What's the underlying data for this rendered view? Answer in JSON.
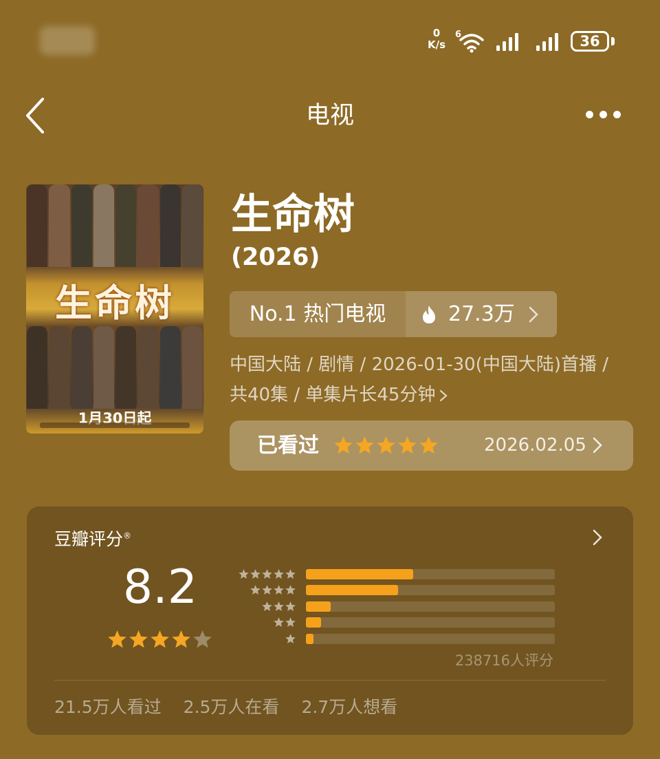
{
  "status_bar": {
    "net_speed_value": "0",
    "net_speed_unit": "K/s",
    "network_type": "6",
    "battery": "36"
  },
  "nav": {
    "title": "电视",
    "back_icon": "chevron-left-icon",
    "more_icon": "more-dots-icon"
  },
  "item": {
    "poster": {
      "logo": "生命树",
      "date": "1月30日起"
    },
    "title": "生命树",
    "year": "(2026)",
    "rank": {
      "label": "No.1 热门电视",
      "heat": "27.3万"
    },
    "meta_line1": "中国大陆 / 剧情 / 2026-01-30(中国大陆)首播 /",
    "meta_line2": "共40集 / 单集片长45分钟",
    "watched": {
      "label": "已看过",
      "my_stars": 5,
      "date": "2026.02.05"
    }
  },
  "rating": {
    "title": "豆瓣评分",
    "reg_mark": "®",
    "score": "8.2",
    "stars": 4,
    "distribution": [
      {
        "stars": 5,
        "fraction": 0.43
      },
      {
        "stars": 4,
        "fraction": 0.37
      },
      {
        "stars": 3,
        "fraction": 0.1
      },
      {
        "stars": 2,
        "fraction": 0.06
      },
      {
        "stars": 1,
        "fraction": 0.03
      }
    ],
    "count": "238716人评分",
    "watched_count": "21.5万人看过",
    "watching_count": "2.5万人在看",
    "wish_count": "2.7万人想看"
  },
  "colors": {
    "background": "#8d6a26",
    "card": "#715420",
    "accent_orange": "#f6a11b",
    "star_gold": "#f5a623"
  }
}
